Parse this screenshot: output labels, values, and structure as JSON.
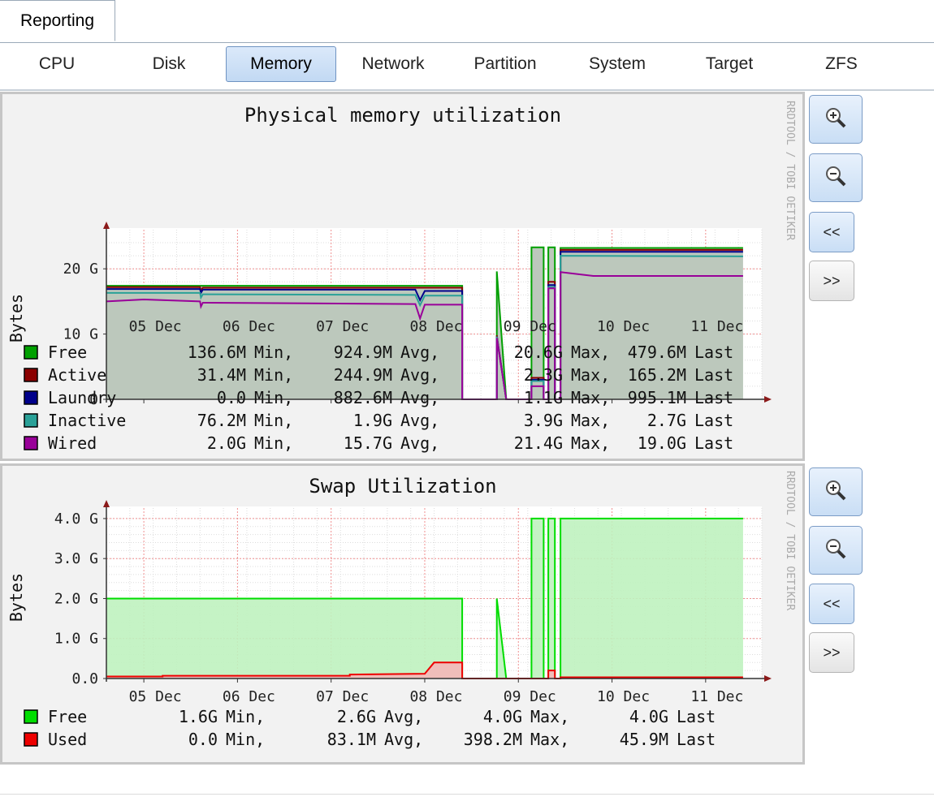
{
  "tabs": {
    "main": "Reporting",
    "sub": [
      {
        "label": "CPU",
        "active": false
      },
      {
        "label": "Disk",
        "active": false
      },
      {
        "label": "Memory",
        "active": true
      },
      {
        "label": "Network",
        "active": false
      },
      {
        "label": "Partition",
        "active": false
      },
      {
        "label": "System",
        "active": false
      },
      {
        "label": "Target",
        "active": false
      },
      {
        "label": "ZFS",
        "active": false
      }
    ]
  },
  "buttons": {
    "zoom_in_icon": "zoom-in-icon",
    "zoom_out_icon": "zoom-out-icon",
    "prev": "<<",
    "next": ">>"
  },
  "watermark": "RRDTOOL / TOBI OETIKER",
  "chart_data": [
    {
      "type": "area",
      "title": "Physical memory utilization",
      "ylabel": "Bytes",
      "xlabel": "",
      "unit": "G",
      "ylim": [
        0,
        25
      ],
      "xlim": [
        4.6,
        11.6
      ],
      "x_ticks": [
        {
          "v": 5,
          "label": "05 Dec"
        },
        {
          "v": 6,
          "label": "06 Dec"
        },
        {
          "v": 7,
          "label": "07 Dec"
        },
        {
          "v": 8,
          "label": "08 Dec"
        },
        {
          "v": 9,
          "label": "09 Dec"
        },
        {
          "v": 10,
          "label": "10 Dec"
        },
        {
          "v": 11,
          "label": "11 Dec"
        }
      ],
      "y_ticks": [
        {
          "v": 0,
          "label": "0"
        },
        {
          "v": 10,
          "label": "10 G"
        },
        {
          "v": 20,
          "label": "20 G"
        }
      ],
      "grid": true,
      "legend_placement": "bottom",
      "series": [
        {
          "name": "Free",
          "color": "#00a000",
          "min": "136.6M",
          "avg": "924.9M",
          "max": "20.6G",
          "last": "479.6M",
          "points": [
            [
              4.6,
              17.4
            ],
            [
              8.4,
              17.4
            ],
            [
              8.4,
              0
            ],
            [
              8.77,
              0
            ],
            [
              8.77,
              19.6
            ],
            [
              8.87,
              0
            ],
            [
              9.14,
              0
            ],
            [
              9.14,
              23.3
            ],
            [
              9.27,
              23.3
            ],
            [
              9.27,
              0
            ],
            [
              9.32,
              0
            ],
            [
              9.32,
              23.3
            ],
            [
              9.39,
              23.3
            ],
            [
              9.39,
              0
            ],
            [
              9.45,
              0
            ],
            [
              9.45,
              23.2
            ],
            [
              11.4,
              23.2
            ]
          ]
        },
        {
          "name": "Active",
          "color": "#8b0000",
          "min": "31.4M",
          "avg": "244.9M",
          "max": "2.3G",
          "last": "165.2M",
          "points": [
            [
              4.6,
              17.2
            ],
            [
              5.6,
              17.2
            ],
            [
              5.61,
              16.6
            ],
            [
              5.63,
              17.1
            ],
            [
              8.4,
              17.1
            ],
            [
              8.4,
              0
            ],
            [
              8.77,
              0
            ],
            [
              8.77,
              9.8
            ],
            [
              8.87,
              0
            ],
            [
              9.14,
              0
            ],
            [
              9.14,
              3.3
            ],
            [
              9.27,
              3.3
            ],
            [
              9.27,
              0
            ],
            [
              9.32,
              0
            ],
            [
              9.32,
              18
            ],
            [
              9.39,
              18
            ],
            [
              9.39,
              0
            ],
            [
              9.45,
              0
            ],
            [
              9.45,
              22.9
            ],
            [
              11.4,
              22.9
            ]
          ]
        },
        {
          "name": "Laundry",
          "color": "#00008b",
          "min": "0.0",
          "avg": "882.6M",
          "max": "1.1G",
          "last": "995.1M",
          "points": [
            [
              4.6,
              16.9
            ],
            [
              5.6,
              16.9
            ],
            [
              5.61,
              16.3
            ],
            [
              5.63,
              16.8
            ],
            [
              7.9,
              16.8
            ],
            [
              7.95,
              15.2
            ],
            [
              8.0,
              16.6
            ],
            [
              8.4,
              16.6
            ],
            [
              8.4,
              0
            ],
            [
              8.77,
              0
            ],
            [
              8.77,
              9.6
            ],
            [
              8.87,
              0
            ],
            [
              9.14,
              0
            ],
            [
              9.14,
              3.0
            ],
            [
              9.27,
              3.0
            ],
            [
              9.27,
              0
            ],
            [
              9.32,
              0
            ],
            [
              9.32,
              17.5
            ],
            [
              9.39,
              17.5
            ],
            [
              9.39,
              0
            ],
            [
              9.45,
              0
            ],
            [
              9.45,
              22.6
            ],
            [
              11.4,
              22.6
            ]
          ]
        },
        {
          "name": "Inactive",
          "color": "#2aa198",
          "min": "76.2M",
          "avg": "1.9G",
          "max": "3.9G",
          "last": "2.7G",
          "points": [
            [
              4.6,
              16.3
            ],
            [
              5.6,
              16.3
            ],
            [
              5.61,
              15.6
            ],
            [
              5.63,
              16.1
            ],
            [
              7.9,
              16.0
            ],
            [
              7.95,
              14.4
            ],
            [
              8.0,
              15.9
            ],
            [
              8.4,
              15.9
            ],
            [
              8.4,
              0
            ],
            [
              8.77,
              0
            ],
            [
              8.77,
              9.6
            ],
            [
              8.87,
              0
            ],
            [
              9.14,
              0
            ],
            [
              9.14,
              2.8
            ],
            [
              9.27,
              2.8
            ],
            [
              9.27,
              0
            ],
            [
              9.32,
              0
            ],
            [
              9.32,
              17.2
            ],
            [
              9.39,
              17.2
            ],
            [
              9.39,
              0
            ],
            [
              9.45,
              0
            ],
            [
              9.45,
              22.0
            ],
            [
              11.4,
              21.9
            ]
          ]
        },
        {
          "name": "Wired",
          "color": "#990099",
          "min": "2.0G",
          "avg": "15.7G",
          "max": "21.4G",
          "last": "19.0G",
          "points": [
            [
              4.6,
              15.0
            ],
            [
              5.0,
              15.3
            ],
            [
              5.6,
              15.0
            ],
            [
              5.61,
              14.2
            ],
            [
              5.63,
              14.8
            ],
            [
              7.9,
              14.6
            ],
            [
              7.95,
              12.4
            ],
            [
              8.0,
              14.5
            ],
            [
              8.4,
              14.5
            ],
            [
              8.4,
              0
            ],
            [
              8.77,
              0
            ],
            [
              8.77,
              9.4
            ],
            [
              8.87,
              0
            ],
            [
              9.14,
              0
            ],
            [
              9.14,
              2.0
            ],
            [
              9.27,
              2.0
            ],
            [
              9.27,
              0
            ],
            [
              9.32,
              0
            ],
            [
              9.32,
              17.0
            ],
            [
              9.39,
              17.0
            ],
            [
              9.39,
              0
            ],
            [
              9.45,
              0
            ],
            [
              9.45,
              19.5
            ],
            [
              9.8,
              18.9
            ],
            [
              11.4,
              18.9
            ]
          ]
        }
      ]
    },
    {
      "type": "area",
      "title": "Swap Utilization",
      "ylabel": "Bytes",
      "xlabel": "",
      "unit": "G",
      "ylim": [
        0,
        4.1
      ],
      "xlim": [
        4.6,
        11.6
      ],
      "x_ticks": [
        {
          "v": 5,
          "label": "05 Dec"
        },
        {
          "v": 6,
          "label": "06 Dec"
        },
        {
          "v": 7,
          "label": "07 Dec"
        },
        {
          "v": 8,
          "label": "08 Dec"
        },
        {
          "v": 9,
          "label": "09 Dec"
        },
        {
          "v": 10,
          "label": "10 Dec"
        },
        {
          "v": 11,
          "label": "11 Dec"
        }
      ],
      "y_ticks": [
        {
          "v": 0,
          "label": "0.0"
        },
        {
          "v": 1,
          "label": "1.0 G"
        },
        {
          "v": 2,
          "label": "2.0 G"
        },
        {
          "v": 3,
          "label": "3.0 G"
        },
        {
          "v": 4,
          "label": "4.0 G"
        }
      ],
      "grid": true,
      "legend_placement": "bottom",
      "series": [
        {
          "name": "Free",
          "color": "#00dd00",
          "fill": "#bff2bf",
          "min": "1.6G",
          "avg": "2.6G",
          "max": "4.0G",
          "last": "4.0G",
          "points": [
            [
              4.6,
              2.0
            ],
            [
              8.4,
              2.0
            ],
            [
              8.4,
              0
            ],
            [
              8.77,
              0
            ],
            [
              8.77,
              2.0
            ],
            [
              8.87,
              0
            ],
            [
              9.14,
              0
            ],
            [
              9.14,
              4.0
            ],
            [
              9.27,
              4.0
            ],
            [
              9.27,
              0
            ],
            [
              9.32,
              0
            ],
            [
              9.32,
              4.0
            ],
            [
              9.39,
              4.0
            ],
            [
              9.39,
              0
            ],
            [
              9.45,
              0
            ],
            [
              9.45,
              4.0
            ],
            [
              11.4,
              4.0
            ]
          ]
        },
        {
          "name": "Used",
          "color": "#ee0000",
          "fill": "#f4b8b8",
          "min": "0.0",
          "avg": "83.1M",
          "max": "398.2M",
          "last": "45.9M",
          "points": [
            [
              4.6,
              0.05
            ],
            [
              5.2,
              0.05
            ],
            [
              5.2,
              0.07
            ],
            [
              7.2,
              0.07
            ],
            [
              7.2,
              0.1
            ],
            [
              8.0,
              0.12
            ],
            [
              8.1,
              0.4
            ],
            [
              8.4,
              0.4
            ],
            [
              8.4,
              0
            ],
            [
              9.32,
              0
            ],
            [
              9.32,
              0.2
            ],
            [
              9.39,
              0.2
            ],
            [
              9.39,
              0
            ],
            [
              9.45,
              0
            ],
            [
              9.45,
              0.03
            ],
            [
              11.4,
              0.03
            ]
          ]
        }
      ]
    }
  ]
}
